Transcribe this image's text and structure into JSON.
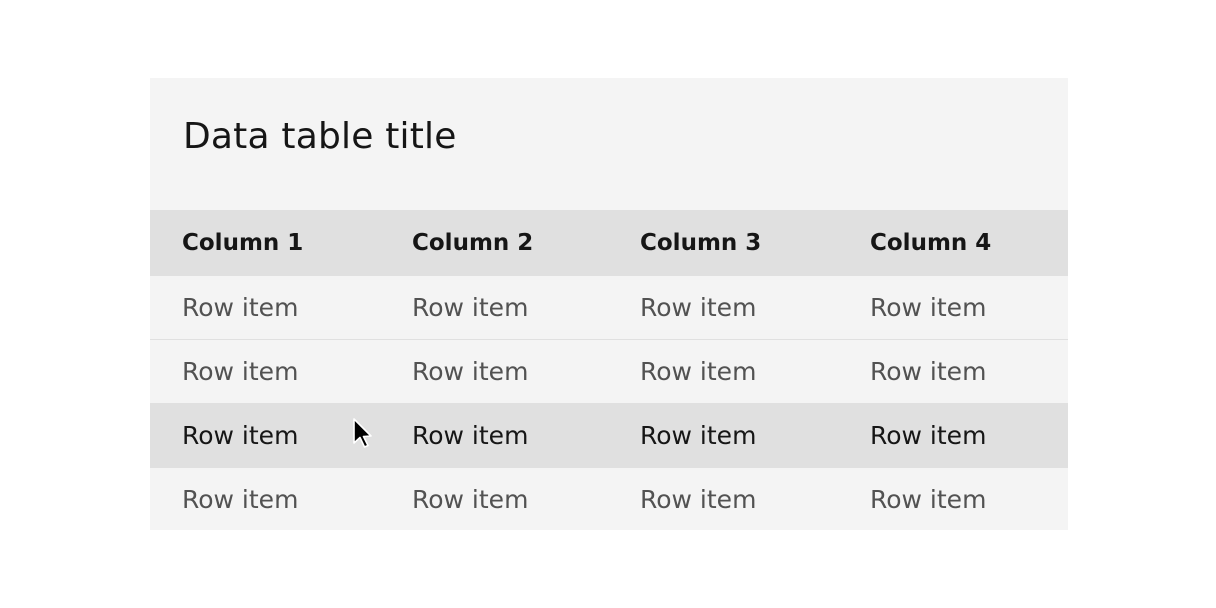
{
  "table": {
    "title": "Data table title",
    "columns": [
      "Column 1",
      "Column 2",
      "Column 3",
      "Column 4"
    ],
    "rows": [
      [
        "Row item",
        "Row item",
        "Row item",
        "Row item"
      ],
      [
        "Row item",
        "Row item",
        "Row item",
        "Row item"
      ],
      [
        "Row item",
        "Row item",
        "Row item",
        "Row item"
      ],
      [
        "Row item",
        "Row item",
        "Row item",
        "Row item"
      ]
    ],
    "hovered_row": 3
  },
  "colors": {
    "background": "#f4f4f4",
    "header": "#e0e0e0",
    "hover": "#e0e0e0",
    "text": "#525252",
    "header_text": "#161616"
  },
  "cursor_icon": "arrow-pointer-icon"
}
